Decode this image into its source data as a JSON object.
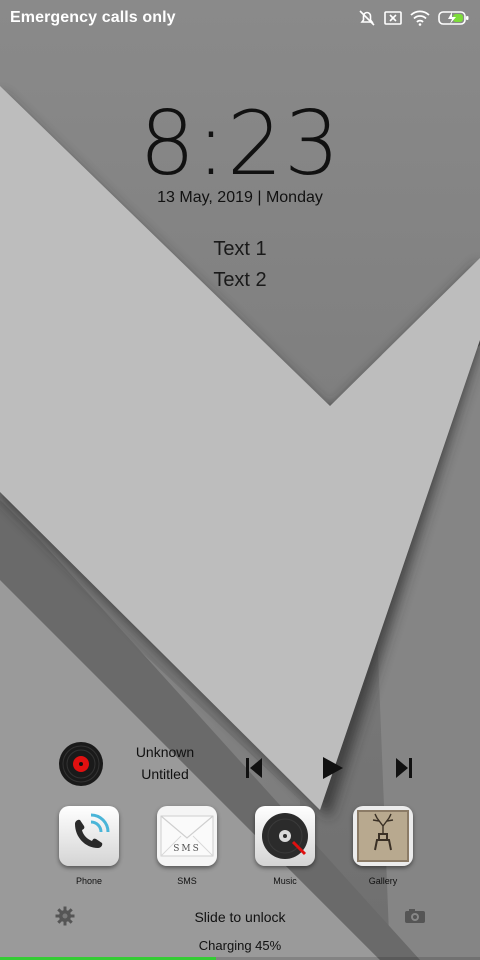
{
  "status_bar": {
    "carrier_text": "Emergency calls only",
    "icons": [
      "alarm-muted-icon",
      "no-sim-icon",
      "wifi-icon",
      "battery-charging-icon"
    ]
  },
  "lock": {
    "time": "8:23",
    "date": "13 May, 2019 | Monday",
    "text1": "Text 1",
    "text2": "Text 2"
  },
  "music": {
    "artist": "Unknown",
    "title": "Untitled",
    "controls": [
      "previous-track-icon",
      "play-icon",
      "next-track-icon"
    ]
  },
  "apps": [
    {
      "label": "Phone",
      "icon": "phone-icon"
    },
    {
      "label": "SMS",
      "icon": "sms-icon",
      "icon_text": "SMS"
    },
    {
      "label": "Music",
      "icon": "music-icon"
    },
    {
      "label": "Gallery",
      "icon": "gallery-icon"
    }
  ],
  "bottom": {
    "unlock_text": "Slide to unlock",
    "charging_text": "Charging  45%",
    "charge_fraction": 0.45
  },
  "colors": {
    "charge_green": "#33cc33",
    "disc_red": "#e01010",
    "battery_green": "#7ddc3a"
  }
}
